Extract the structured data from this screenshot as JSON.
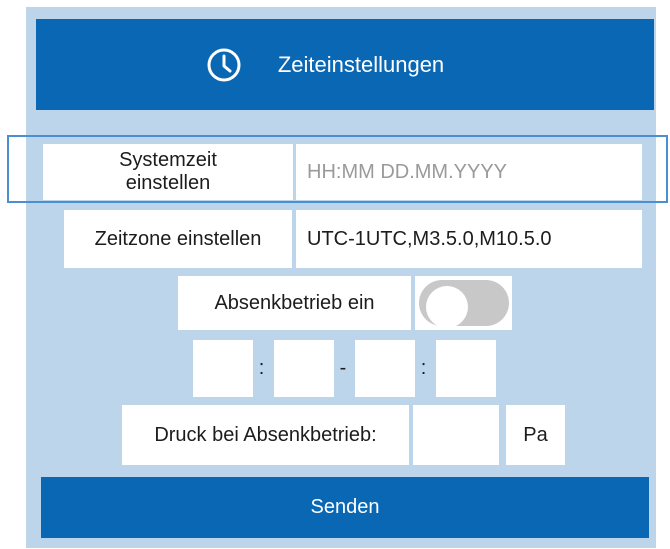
{
  "header": {
    "title": "Zeiteinstellungen",
    "icon": "clock-icon"
  },
  "system_time": {
    "label": "Systemzeit\neinstellen",
    "label_line1": "Systemzeit",
    "label_line2": "einstellen",
    "placeholder": "HH:MM DD.MM.YYYY"
  },
  "timezone": {
    "label": "Zeitzone einstellen",
    "value": "UTC-1UTC,M3.5.0,M10.5.0"
  },
  "setback": {
    "label": "Absenkbetrieb ein",
    "enabled": false,
    "time_separator": ":",
    "range_separator": "-"
  },
  "pressure": {
    "label": "Druck bei Absenkbetrieb:",
    "unit": "Pa",
    "value": ""
  },
  "send_button": {
    "label": "Senden"
  },
  "colors": {
    "accent": "#0a67b4",
    "panel_background": "#bdd5ea",
    "focus_border": "#4b8fd1",
    "toggle_off": "#c8c8c8"
  }
}
